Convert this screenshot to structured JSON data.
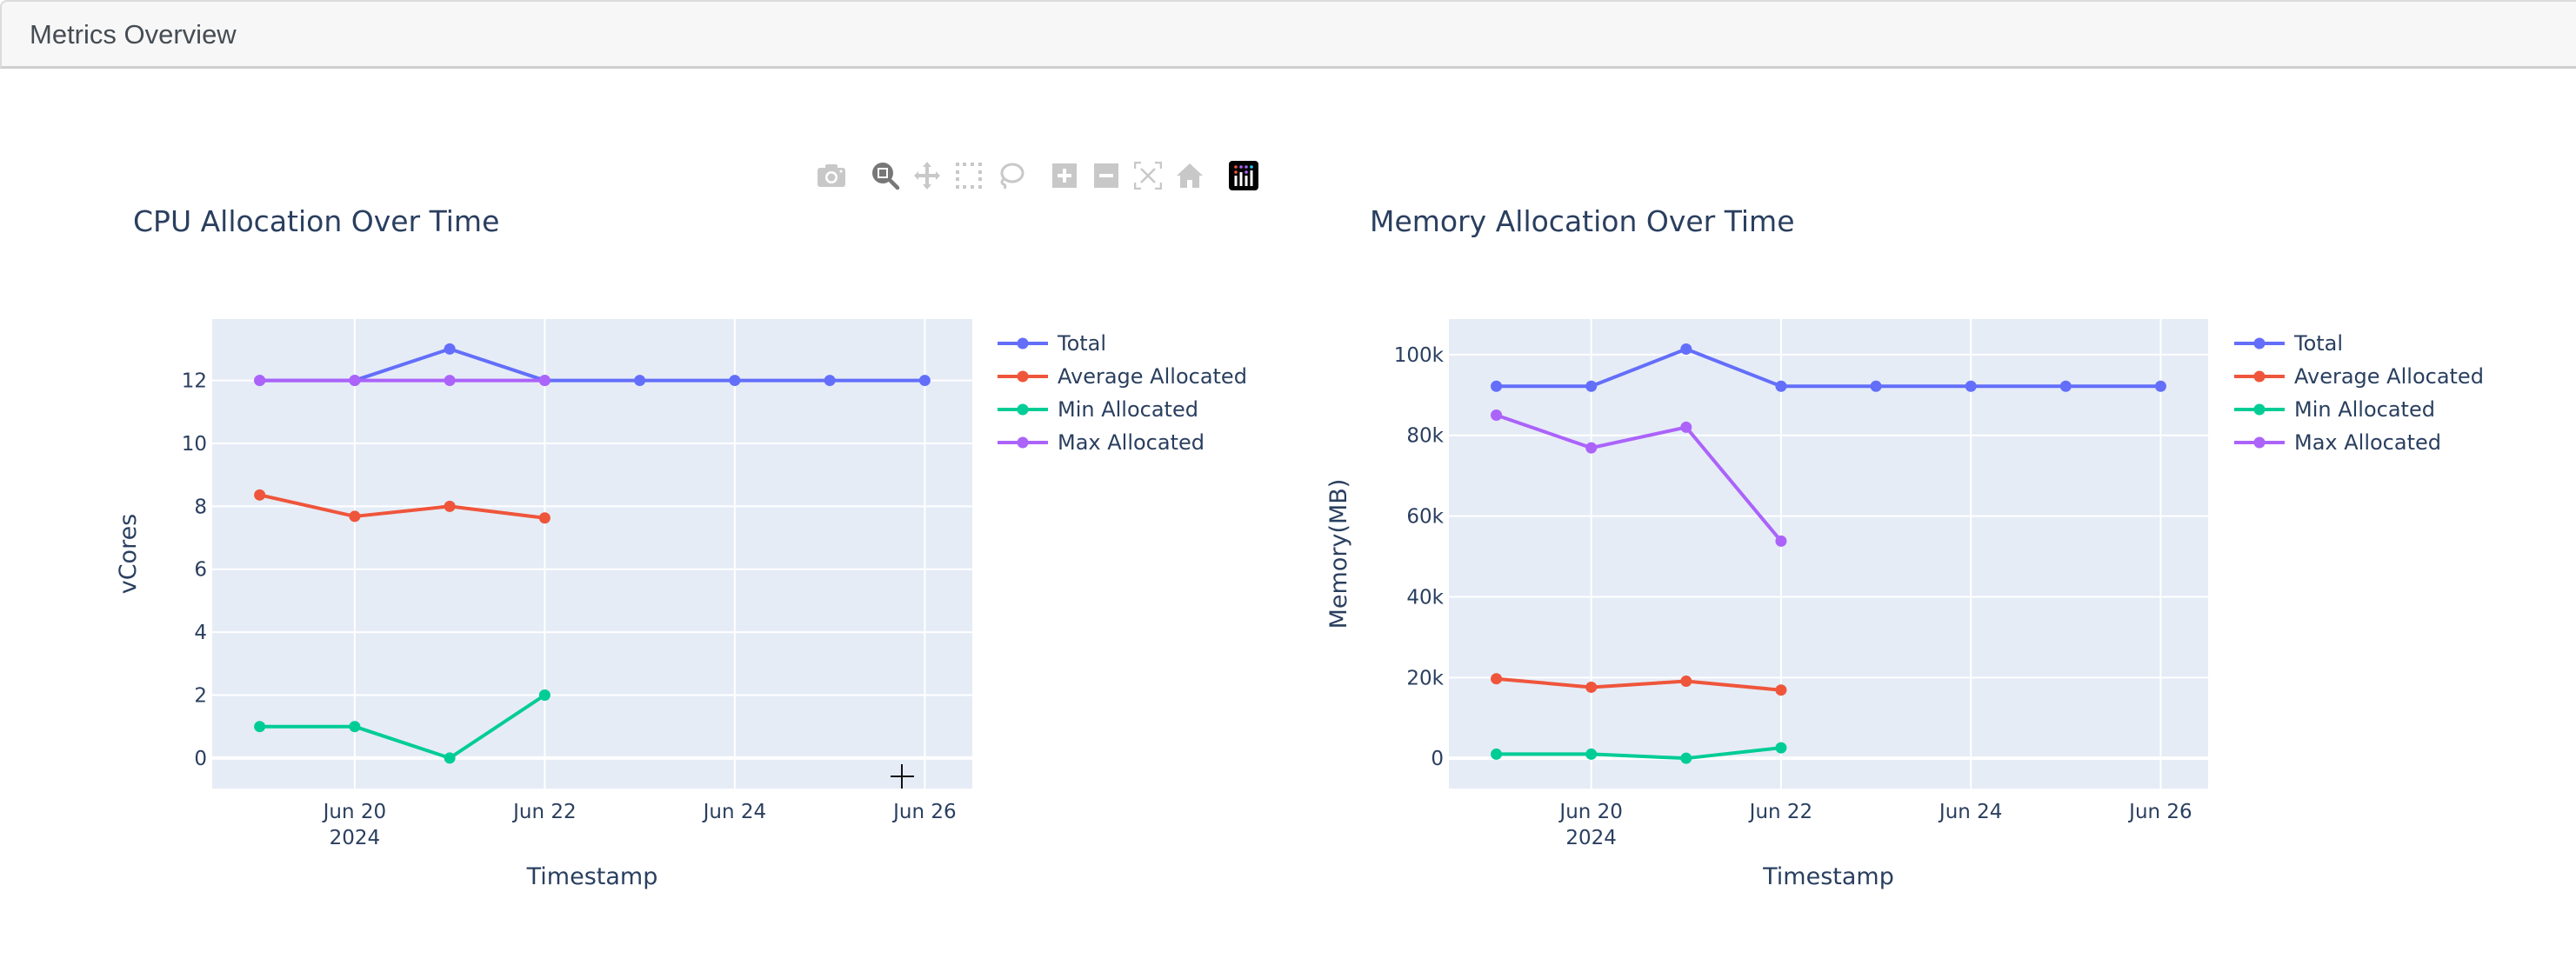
{
  "header": {
    "title": "Metrics Overview"
  },
  "modebar": {
    "buttons": [
      {
        "name": "download-png",
        "icon": "camera-icon",
        "active": false
      },
      {
        "name": "zoom",
        "icon": "zoom-icon",
        "active": true
      },
      {
        "name": "pan",
        "icon": "pan-icon",
        "active": false
      },
      {
        "name": "box-select",
        "icon": "box-select-icon",
        "active": false
      },
      {
        "name": "lasso-select",
        "icon": "lasso-icon",
        "active": false
      },
      {
        "name": "zoom-in",
        "icon": "zoom-in-icon",
        "active": false
      },
      {
        "name": "zoom-out",
        "icon": "zoom-out-icon",
        "active": false
      },
      {
        "name": "autoscale",
        "icon": "autoscale-icon",
        "active": false
      },
      {
        "name": "reset-axes",
        "icon": "home-icon",
        "active": false
      },
      {
        "name": "plotly-logo",
        "icon": "plotly-logo-icon",
        "active": false
      }
    ]
  },
  "colors": {
    "Total": "#636efa",
    "Average Allocated": "#ef553b",
    "Min Allocated": "#00cc96",
    "Max Allocated": "#ab63fa",
    "plot_bg": "#e5ecf6",
    "grid": "#ffffff",
    "text": "#2a3f5f"
  },
  "chart_data": [
    {
      "id": "cpu",
      "type": "line",
      "title": "CPU Allocation Over Time",
      "xlabel": "Timestamp",
      "ylabel": "vCores",
      "x": [
        "2024-06-19",
        "2024-06-20",
        "2024-06-21",
        "2024-06-22",
        "2024-06-23",
        "2024-06-24",
        "2024-06-25",
        "2024-06-26"
      ],
      "xlim": [
        "2024-06-18 12:00",
        "2024-06-26 12:00"
      ],
      "xticks": [
        {
          "date": "2024-06-20",
          "label": "Jun 20",
          "sublabel": "2024"
        },
        {
          "date": "2024-06-22",
          "label": "Jun 22",
          "sublabel": ""
        },
        {
          "date": "2024-06-24",
          "label": "Jun 24",
          "sublabel": ""
        },
        {
          "date": "2024-06-26",
          "label": "Jun 26",
          "sublabel": ""
        }
      ],
      "ylim": [
        -0.97,
        13.95
      ],
      "yticks": [
        0,
        2,
        4,
        6,
        8,
        10,
        12
      ],
      "ytick_labels": [
        "0",
        "2",
        "4",
        "6",
        "8",
        "10",
        "12"
      ],
      "grid": true,
      "legend_position": "right",
      "series": [
        {
          "name": "Total",
          "values": [
            12,
            12,
            13,
            12,
            12,
            12,
            12,
            12
          ]
        },
        {
          "name": "Average Allocated",
          "values": [
            8.36,
            7.68,
            8.0,
            7.63
          ]
        },
        {
          "name": "Min Allocated",
          "values": [
            1,
            1,
            0,
            2
          ]
        },
        {
          "name": "Max Allocated",
          "values": [
            12,
            12,
            12,
            12
          ]
        }
      ]
    },
    {
      "id": "memory",
      "type": "line",
      "title": "Memory Allocation Over Time",
      "xlabel": "Timestamp",
      "ylabel": "Memory(MB)",
      "x": [
        "2024-06-19",
        "2024-06-20",
        "2024-06-21",
        "2024-06-22",
        "2024-06-23",
        "2024-06-24",
        "2024-06-25",
        "2024-06-26"
      ],
      "xlim": [
        "2024-06-18 12:00",
        "2024-06-26 12:00"
      ],
      "xticks": [
        {
          "date": "2024-06-20",
          "label": "Jun 20",
          "sublabel": "2024"
        },
        {
          "date": "2024-06-22",
          "label": "Jun 22",
          "sublabel": ""
        },
        {
          "date": "2024-06-24",
          "label": "Jun 24",
          "sublabel": ""
        },
        {
          "date": "2024-06-26",
          "label": "Jun 26",
          "sublabel": ""
        }
      ],
      "ylim": [
        -7500,
        108800
      ],
      "yticks": [
        0,
        20000,
        40000,
        60000,
        80000,
        100000
      ],
      "ytick_labels": [
        "0",
        "20k",
        "40k",
        "60k",
        "80k",
        "100k"
      ],
      "grid": true,
      "legend_position": "right",
      "series": [
        {
          "name": "Total",
          "values": [
            92160,
            92160,
            101376,
            92160,
            92160,
            92160,
            92160,
            92160
          ]
        },
        {
          "name": "Average Allocated",
          "values": [
            19700,
            17600,
            19100,
            16900
          ]
        },
        {
          "name": "Min Allocated",
          "values": [
            1024,
            1024,
            0,
            2600
          ]
        },
        {
          "name": "Max Allocated",
          "values": [
            85000,
            76900,
            82000,
            53800
          ]
        }
      ]
    }
  ]
}
